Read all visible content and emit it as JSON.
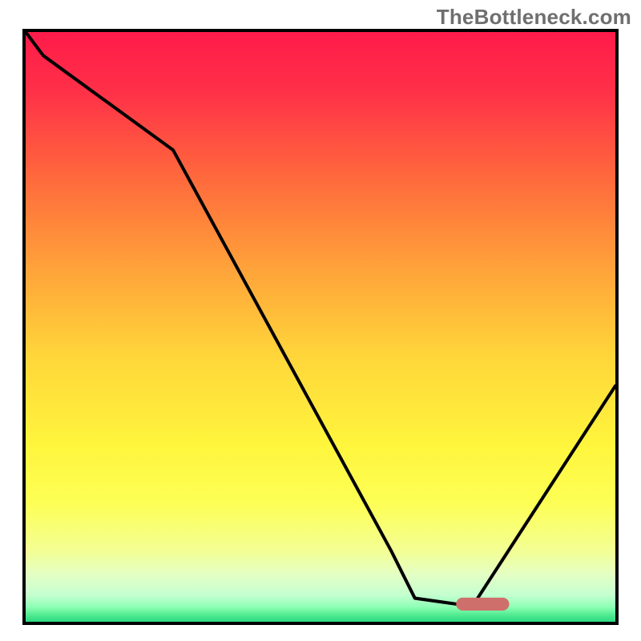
{
  "watermark": "TheBottleneck.com",
  "chart_data": {
    "type": "line",
    "title": "",
    "xlabel": "",
    "ylabel": "",
    "xlim": [
      0,
      100
    ],
    "ylim": [
      0,
      100
    ],
    "grid": false,
    "series": [
      {
        "name": "curve",
        "x": [
          0,
          3,
          25,
          62,
          66,
          73,
          76,
          100
        ],
        "values": [
          100,
          96,
          80,
          12,
          4,
          3,
          3,
          40
        ]
      }
    ],
    "marker": {
      "x_start": 73,
      "x_end": 82,
      "y": 3,
      "color": "#cf6f6b"
    },
    "gradient_stops": [
      {
        "offset": 0.0,
        "color": "#ff1b4a"
      },
      {
        "offset": 0.1,
        "color": "#ff3048"
      },
      {
        "offset": 0.25,
        "color": "#ff6a3c"
      },
      {
        "offset": 0.4,
        "color": "#ffa23a"
      },
      {
        "offset": 0.55,
        "color": "#ffd63a"
      },
      {
        "offset": 0.7,
        "color": "#fff53c"
      },
      {
        "offset": 0.8,
        "color": "#fdff56"
      },
      {
        "offset": 0.88,
        "color": "#f3ff94"
      },
      {
        "offset": 0.92,
        "color": "#e4ffc4"
      },
      {
        "offset": 0.955,
        "color": "#c4ffd0"
      },
      {
        "offset": 0.975,
        "color": "#8dffb4"
      },
      {
        "offset": 0.99,
        "color": "#4be88e"
      },
      {
        "offset": 1.0,
        "color": "#2fd983"
      }
    ]
  }
}
